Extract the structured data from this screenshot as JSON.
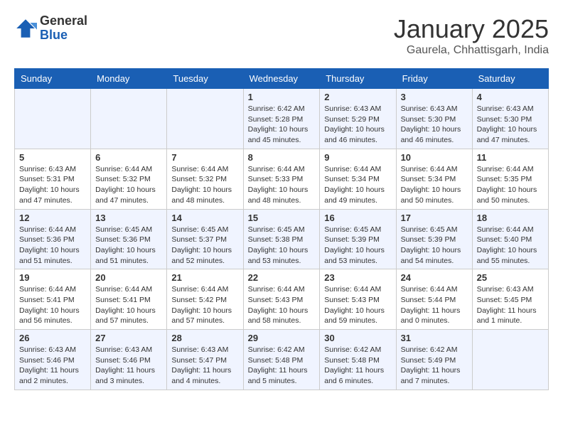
{
  "header": {
    "logo_general": "General",
    "logo_blue": "Blue",
    "title": "January 2025",
    "subtitle": "Gaurela, Chhattisgarh, India"
  },
  "days_of_week": [
    "Sunday",
    "Monday",
    "Tuesday",
    "Wednesday",
    "Thursday",
    "Friday",
    "Saturday"
  ],
  "weeks": [
    [
      {
        "day": "",
        "info": ""
      },
      {
        "day": "",
        "info": ""
      },
      {
        "day": "",
        "info": ""
      },
      {
        "day": "1",
        "info": "Sunrise: 6:42 AM\nSunset: 5:28 PM\nDaylight: 10 hours\nand 45 minutes."
      },
      {
        "day": "2",
        "info": "Sunrise: 6:43 AM\nSunset: 5:29 PM\nDaylight: 10 hours\nand 46 minutes."
      },
      {
        "day": "3",
        "info": "Sunrise: 6:43 AM\nSunset: 5:30 PM\nDaylight: 10 hours\nand 46 minutes."
      },
      {
        "day": "4",
        "info": "Sunrise: 6:43 AM\nSunset: 5:30 PM\nDaylight: 10 hours\nand 47 minutes."
      }
    ],
    [
      {
        "day": "5",
        "info": "Sunrise: 6:43 AM\nSunset: 5:31 PM\nDaylight: 10 hours\nand 47 minutes."
      },
      {
        "day": "6",
        "info": "Sunrise: 6:44 AM\nSunset: 5:32 PM\nDaylight: 10 hours\nand 47 minutes."
      },
      {
        "day": "7",
        "info": "Sunrise: 6:44 AM\nSunset: 5:32 PM\nDaylight: 10 hours\nand 48 minutes."
      },
      {
        "day": "8",
        "info": "Sunrise: 6:44 AM\nSunset: 5:33 PM\nDaylight: 10 hours\nand 48 minutes."
      },
      {
        "day": "9",
        "info": "Sunrise: 6:44 AM\nSunset: 5:34 PM\nDaylight: 10 hours\nand 49 minutes."
      },
      {
        "day": "10",
        "info": "Sunrise: 6:44 AM\nSunset: 5:34 PM\nDaylight: 10 hours\nand 50 minutes."
      },
      {
        "day": "11",
        "info": "Sunrise: 6:44 AM\nSunset: 5:35 PM\nDaylight: 10 hours\nand 50 minutes."
      }
    ],
    [
      {
        "day": "12",
        "info": "Sunrise: 6:44 AM\nSunset: 5:36 PM\nDaylight: 10 hours\nand 51 minutes."
      },
      {
        "day": "13",
        "info": "Sunrise: 6:45 AM\nSunset: 5:36 PM\nDaylight: 10 hours\nand 51 minutes."
      },
      {
        "day": "14",
        "info": "Sunrise: 6:45 AM\nSunset: 5:37 PM\nDaylight: 10 hours\nand 52 minutes."
      },
      {
        "day": "15",
        "info": "Sunrise: 6:45 AM\nSunset: 5:38 PM\nDaylight: 10 hours\nand 53 minutes."
      },
      {
        "day": "16",
        "info": "Sunrise: 6:45 AM\nSunset: 5:39 PM\nDaylight: 10 hours\nand 53 minutes."
      },
      {
        "day": "17",
        "info": "Sunrise: 6:45 AM\nSunset: 5:39 PM\nDaylight: 10 hours\nand 54 minutes."
      },
      {
        "day": "18",
        "info": "Sunrise: 6:44 AM\nSunset: 5:40 PM\nDaylight: 10 hours\nand 55 minutes."
      }
    ],
    [
      {
        "day": "19",
        "info": "Sunrise: 6:44 AM\nSunset: 5:41 PM\nDaylight: 10 hours\nand 56 minutes."
      },
      {
        "day": "20",
        "info": "Sunrise: 6:44 AM\nSunset: 5:41 PM\nDaylight: 10 hours\nand 57 minutes."
      },
      {
        "day": "21",
        "info": "Sunrise: 6:44 AM\nSunset: 5:42 PM\nDaylight: 10 hours\nand 57 minutes."
      },
      {
        "day": "22",
        "info": "Sunrise: 6:44 AM\nSunset: 5:43 PM\nDaylight: 10 hours\nand 58 minutes."
      },
      {
        "day": "23",
        "info": "Sunrise: 6:44 AM\nSunset: 5:43 PM\nDaylight: 10 hours\nand 59 minutes."
      },
      {
        "day": "24",
        "info": "Sunrise: 6:44 AM\nSunset: 5:44 PM\nDaylight: 11 hours\nand 0 minutes."
      },
      {
        "day": "25",
        "info": "Sunrise: 6:43 AM\nSunset: 5:45 PM\nDaylight: 11 hours\nand 1 minute."
      }
    ],
    [
      {
        "day": "26",
        "info": "Sunrise: 6:43 AM\nSunset: 5:46 PM\nDaylight: 11 hours\nand 2 minutes."
      },
      {
        "day": "27",
        "info": "Sunrise: 6:43 AM\nSunset: 5:46 PM\nDaylight: 11 hours\nand 3 minutes."
      },
      {
        "day": "28",
        "info": "Sunrise: 6:43 AM\nSunset: 5:47 PM\nDaylight: 11 hours\nand 4 minutes."
      },
      {
        "day": "29",
        "info": "Sunrise: 6:42 AM\nSunset: 5:48 PM\nDaylight: 11 hours\nand 5 minutes."
      },
      {
        "day": "30",
        "info": "Sunrise: 6:42 AM\nSunset: 5:48 PM\nDaylight: 11 hours\nand 6 minutes."
      },
      {
        "day": "31",
        "info": "Sunrise: 6:42 AM\nSunset: 5:49 PM\nDaylight: 11 hours\nand 7 minutes."
      },
      {
        "day": "",
        "info": ""
      }
    ]
  ]
}
